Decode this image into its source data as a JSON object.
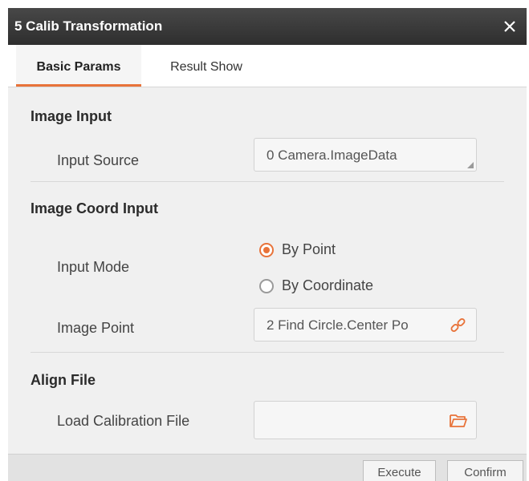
{
  "window": {
    "title": "5 Calib Transformation",
    "close_icon": "close-icon"
  },
  "tabs": [
    {
      "label": "Basic Params",
      "active": true
    },
    {
      "label": "Result Show",
      "active": false
    }
  ],
  "image_input": {
    "section_title": "Image Input",
    "input_source_label": "Input Source",
    "input_source_value": "0 Camera.ImageData"
  },
  "image_coord_input": {
    "section_title": "Image Coord Input",
    "input_mode_label": "Input Mode",
    "options": [
      {
        "label": "By Point",
        "selected": true
      },
      {
        "label": "By Coordinate",
        "selected": false
      }
    ],
    "image_point_label": "Image Point",
    "image_point_value": "2 Find Circle.Center Po",
    "image_point_icon": "link-icon"
  },
  "align_file": {
    "section_title": "Align File",
    "load_calibration_label": "Load Calibration File",
    "load_calibration_value": "",
    "folder_icon": "folder-open-icon"
  },
  "footer": {
    "execute_label": "Execute",
    "confirm_label": "Confirm"
  },
  "colors": {
    "accent": "#e8733a",
    "titlebar": "#3a3a3a",
    "panel_bg": "#f0f0f0"
  }
}
